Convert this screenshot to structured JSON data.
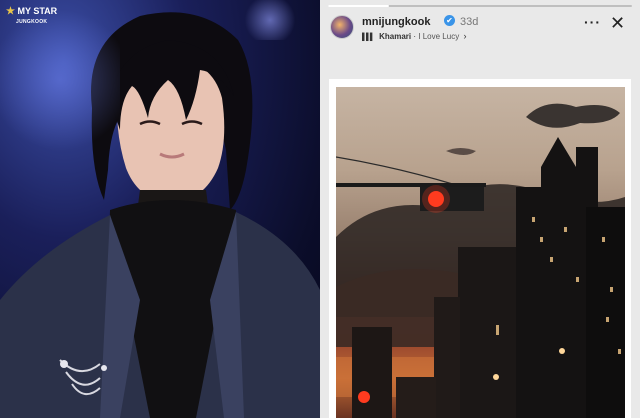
{
  "left_panel": {
    "watermark": {
      "title": "MY STAR",
      "subtitle": "JUNGKOOK"
    }
  },
  "story": {
    "progress": 0.2,
    "username": "mnijungkook",
    "verified_icon": "✔",
    "time": "33d",
    "music": {
      "icon": "music-bars-icon",
      "artist": "Khamari",
      "separator": "·",
      "song": "I Love Lucy"
    },
    "more_label": "···",
    "close_label": "✕"
  },
  "colors": {
    "story_bg": "#e9e9e9",
    "verified": "#3a94e8",
    "traffic_light": "#ff3b1f"
  }
}
